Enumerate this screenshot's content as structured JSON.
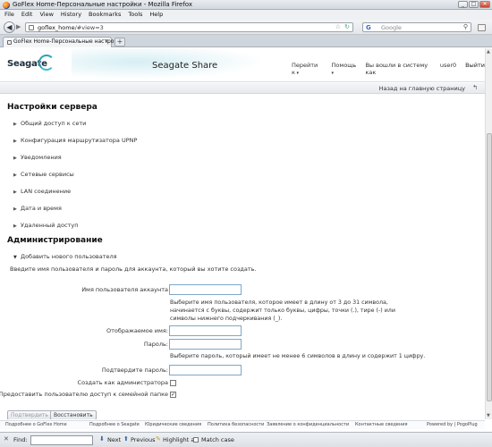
{
  "window": {
    "title": "GoFlex Home-Персональные настройки - Mozilla Firefox",
    "controls": [
      "_",
      "□",
      "✕"
    ]
  },
  "menubar": [
    "File",
    "Edit",
    "View",
    "History",
    "Bookmarks",
    "Tools",
    "Help"
  ],
  "navbar": {
    "url_host": "goflex_home",
    "url_path": "/#view=3",
    "search_engine": "Google",
    "search_placeholder": "Google"
  },
  "tab": {
    "label": "GoFlex Home-Персональные настройки",
    "close": "x",
    "new_tab": "+"
  },
  "header": {
    "logo": "Seagate",
    "app_title": "Seagate Share",
    "nav": {
      "goto": "Перейти к",
      "help": "Помощь",
      "logged_in_as": "Вы вошли в систему как",
      "username": "user0",
      "logout": "Выйти"
    },
    "back_link": "Назад на главную страницу"
  },
  "server_settings": {
    "title": "Настройки сервера",
    "items": [
      "Общий доступ к сети",
      "Конфигурация маршрутизатора UPNP",
      "Уведомления",
      "Сетевые сервисы",
      "LAN соединение",
      "Дата и время",
      "Удаленный доступ"
    ]
  },
  "administration": {
    "title": "Администрирование",
    "add_user": "Добавить нового пользователя",
    "intro": "Введите имя пользователя и пароль для аккаунта, который вы хотите создать.",
    "form": {
      "account_label": "Имя пользователя аккаунта",
      "account_help": "Выберите имя пользователя, которое имеет в длину от 3 до 31 символа, начинается с буквы, содержит только буквы, цифры, точки (.), тире (-) или символы нижнего подчеркивания (_).",
      "display_label": "Отображаемое имя:",
      "password_label": "Пароль:",
      "password_help": "Выберите пароль, который имеет не менее 6 символов в длину и содержит 1 цифру.",
      "confirm_label": "Подтвердите пароль:",
      "admin_label": "Создать как администратора",
      "admin_checked": false,
      "family_label": "Предоставить пользователю доступ к семейной папке",
      "family_checked": true,
      "account_value": "",
      "display_value": "",
      "password_value": "",
      "confirm_value": ""
    },
    "buttons": {
      "confirm": "Подтвердить",
      "restore": "Восстановить"
    }
  },
  "footer": {
    "links": [
      "Подробнее о GoFlex Home",
      "Подробнее о Seagate",
      "Юридические сведения",
      "Политика безопасности",
      "Заявление о конфиденциальности",
      "Контактные сведения"
    ],
    "powered": "Powered by | PogoPlug"
  },
  "findbar": {
    "label": "Find:",
    "value": "",
    "next": "Next",
    "previous": "Previous",
    "highlight": "Highlight all",
    "match_case": "Match case"
  }
}
